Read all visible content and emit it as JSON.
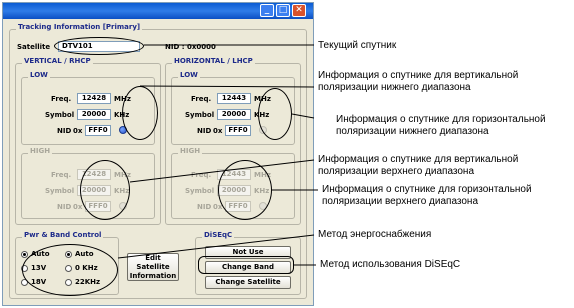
{
  "window": {
    "min": "_",
    "max": "□",
    "close": "✕"
  },
  "tracking": {
    "title": "Tracking Information [Primary]",
    "satellite_label": "Satellite",
    "satellite_value": "DTV101",
    "nid_label": "NID :",
    "nid_value": "0x0000"
  },
  "vertical": {
    "title": "VERTICAL / RHCP",
    "low": {
      "title": "LOW",
      "freq_label": "Freq.",
      "freq": "12428",
      "freq_unit": "MHz",
      "symbol_label": "Symbol",
      "symbol": "20000",
      "symbol_unit": "KHz",
      "nid_label": "NID",
      "nid_prefix": "0x",
      "nid": "FFF0"
    },
    "high": {
      "title": "HIGH",
      "freq_label": "Freq.",
      "freq": "12428",
      "freq_unit": "MHz",
      "symbol_label": "Symbol",
      "symbol": "20000",
      "symbol_unit": "KHz",
      "nid_label": "NID",
      "nid_prefix": "0x",
      "nid": "FFF0"
    }
  },
  "horizontal": {
    "title": "HORIZONTAL / LHCP",
    "low": {
      "title": "LOW",
      "freq_label": "Freq.",
      "freq": "12443",
      "freq_unit": "MHz",
      "symbol_label": "Symbol",
      "symbol": "20000",
      "symbol_unit": "KHz",
      "nid_label": "NID",
      "nid_prefix": "0x",
      "nid": "FFF0"
    },
    "high": {
      "title": "HIGH",
      "freq_label": "Freq.",
      "freq": "12443",
      "freq_unit": "MHz",
      "symbol_label": "Symbol",
      "symbol": "20000",
      "symbol_unit": "KHz",
      "nid_label": "NID",
      "nid_prefix": "0x",
      "nid": "FFF0"
    }
  },
  "power": {
    "title": "Pwr & Band Control",
    "left": [
      "Auto",
      "13V",
      "18V"
    ],
    "right": [
      "Auto",
      "0 KHz",
      "22KHz"
    ]
  },
  "edit_button": "Edit Satellite Information",
  "diseqc": {
    "title": "DiSEqC",
    "not_use": "Not Use",
    "change_band": "Change Band",
    "change_satellite": "Change Satellite"
  },
  "annotations": {
    "a1": "Текущий спутник",
    "a2_l1": "Информация о спутнике для вертикальной",
    "a2_l2": "поляризации нижнего диапазона",
    "a3_l1": "Информация о спутнике для горизонтальной",
    "a3_l2": "поляризации нижнего диапазона",
    "a4_l1": "Информация о спутнике для вертикальной",
    "a4_l2": "поляризации верхнего диапазона",
    "a5_l1": "Информация о спутнике для горизонтальной",
    "a5_l2": "поляризации верхнего диапазона",
    "a6": "Метод энергоснабжения",
    "a7": "Метод использования DiSEqC"
  }
}
